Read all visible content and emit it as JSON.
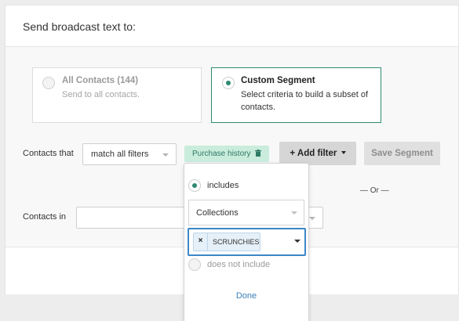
{
  "header": {
    "title": "Send broadcast text to:"
  },
  "audience_options": [
    {
      "title": "All Contacts (144)",
      "description": "Send to all contacts.",
      "selected": false
    },
    {
      "title": "Custom Segment",
      "description": "Select criteria to build a subset of contacts.",
      "selected": true
    }
  ],
  "filters": {
    "contacts_that_label": "Contacts that",
    "match_mode": "match all filters",
    "active_filter_tag": "Purchase history",
    "add_filter_label": "+ Add filter",
    "save_segment_label": "Save Segment",
    "or_separator": "— Or —",
    "contacts_in_label": "Contacts in",
    "contacts_in_value": ""
  },
  "filter_popover": {
    "includes_label": "includes",
    "includes_selected": true,
    "scope_select": "Collections",
    "selected_chips": [
      "SCRUNCHIES"
    ],
    "remove_chip_symbol": "×",
    "does_not_include_label": "does not include",
    "done_label": "Done"
  },
  "colors": {
    "accent": "#2f8a72",
    "tag_bg": "#c9ecdd",
    "focus_blue": "#3a87c6",
    "link_blue": "#3a7fb8"
  }
}
